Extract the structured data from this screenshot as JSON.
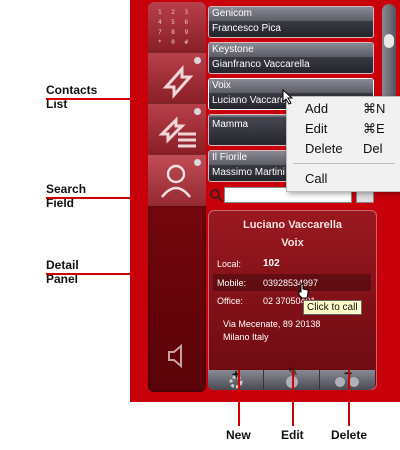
{
  "callouts": {
    "contacts_list": [
      "Contacts",
      "List"
    ],
    "search_field": [
      "Search",
      "Field"
    ],
    "detail_panel": [
      "Detail",
      "Panel"
    ],
    "new": "New",
    "edit": "Edit",
    "delete": "Delete"
  },
  "toolbar": {
    "keypad": "1 2 3 4 5 6 7 8 9 * 0 #"
  },
  "contacts": [
    {
      "org": "Genicom",
      "name": "Francesco Pica"
    },
    {
      "org": "Keystone",
      "name": "Gianfranco Vaccarella"
    },
    {
      "org": "Voix",
      "name": "Luciano Vaccarella"
    },
    {
      "org": "",
      "name": "Mamma"
    },
    {
      "org": "Il Fiorile",
      "name": "Massimo Martini"
    }
  ],
  "context_menu": [
    {
      "label": "Add",
      "shortcut": "⌘N"
    },
    {
      "label": "Edit",
      "shortcut": "⌘E"
    },
    {
      "label": "Delete",
      "shortcut": "Del"
    },
    {
      "label": "Call",
      "shortcut": ""
    }
  ],
  "search": {
    "value": ""
  },
  "detail": {
    "name": "Luciano Vaccarella",
    "company": "Voix",
    "local_label": "Local:",
    "local_value": "102",
    "mobile_label": "Mobile:",
    "mobile_value": "03928534997",
    "office_label": "Office:",
    "office_value": "02 37050401",
    "address1": "Via Mecenate, 89 20138",
    "address2": "Milano Italy",
    "tooltip": "Click to call"
  },
  "bottom_bar": {
    "add_glyph": "+",
    "edit_glyph": "✎",
    "delete_glyph": "−"
  },
  "colors": {
    "accent": "#c8000a",
    "callout_line": "#d40000"
  }
}
